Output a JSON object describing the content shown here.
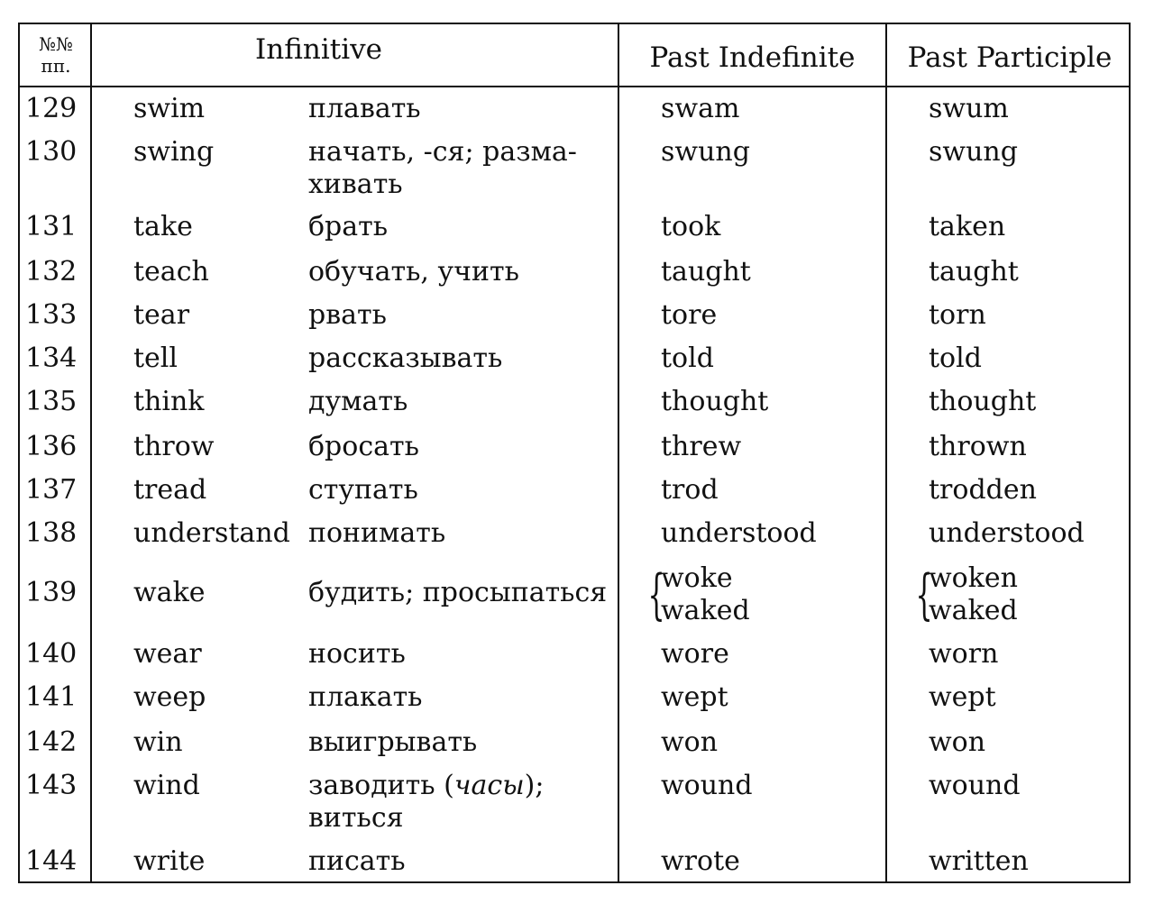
{
  "header": {
    "num_line1": "№№",
    "num_line2": "пп.",
    "infinitive": "Infinitive",
    "past_indefinite": "Past Indefinite",
    "past_participle": "Past Participle"
  },
  "rows": [
    {
      "num": "129",
      "en": "swim",
      "ru": [
        [
          {
            "t": "плавать"
          }
        ]
      ],
      "past": [
        "swam"
      ],
      "pp": [
        "swum"
      ]
    },
    {
      "num": "130",
      "en": "swing",
      "ru": [
        [
          {
            "t": "начать, -ся; разма-"
          }
        ],
        [
          {
            "t": "хивать"
          }
        ]
      ],
      "past": [
        "swung"
      ],
      "pp": [
        "swung"
      ]
    },
    {
      "num": "131",
      "en": "take",
      "ru": [
        [
          {
            "t": "брать"
          }
        ]
      ],
      "past": [
        "took"
      ],
      "pp": [
        "taken"
      ]
    },
    {
      "num": "132",
      "en": "teach",
      "ru": [
        [
          {
            "t": "обучать, учить"
          }
        ]
      ],
      "past": [
        "taught"
      ],
      "pp": [
        "taught"
      ]
    },
    {
      "num": "133",
      "en": "tear",
      "ru": [
        [
          {
            "t": "рвать"
          }
        ]
      ],
      "past": [
        "tore"
      ],
      "pp": [
        "torn"
      ]
    },
    {
      "num": "134",
      "en": "tell",
      "ru": [
        [
          {
            "t": "рассказывать"
          }
        ]
      ],
      "past": [
        "told"
      ],
      "pp": [
        "told"
      ]
    },
    {
      "num": "135",
      "en": "think",
      "ru": [
        [
          {
            "t": "думать"
          }
        ]
      ],
      "past": [
        "thought"
      ],
      "pp": [
        "thought"
      ]
    },
    {
      "num": "136",
      "en": "throw",
      "ru": [
        [
          {
            "t": "бросать"
          }
        ]
      ],
      "past": [
        "threw"
      ],
      "pp": [
        "thrown"
      ]
    },
    {
      "num": "137",
      "en": "tread",
      "ru": [
        [
          {
            "t": "ступать"
          }
        ]
      ],
      "past": [
        "trod"
      ],
      "pp": [
        "trodden"
      ]
    },
    {
      "num": "138",
      "en": "understand",
      "ru": [
        [
          {
            "t": "понимать"
          }
        ]
      ],
      "past": [
        "understood"
      ],
      "pp": [
        "understood"
      ]
    },
    {
      "num": "139",
      "en": "wake",
      "ru": [
        [
          {
            "t": "будить; просыпаться"
          }
        ]
      ],
      "past": [
        "woke",
        "waked"
      ],
      "pp": [
        "woken",
        "waked"
      ]
    },
    {
      "num": "140",
      "en": "wear",
      "ru": [
        [
          {
            "t": "носить"
          }
        ]
      ],
      "past": [
        "wore"
      ],
      "pp": [
        "worn"
      ]
    },
    {
      "num": "141",
      "en": "weep",
      "ru": [
        [
          {
            "t": "плакать"
          }
        ]
      ],
      "past": [
        "wept"
      ],
      "pp": [
        "wept"
      ]
    },
    {
      "num": "142",
      "en": "win",
      "ru": [
        [
          {
            "t": "выигрывать"
          }
        ]
      ],
      "past": [
        "won"
      ],
      "pp": [
        "won"
      ]
    },
    {
      "num": "143",
      "en": "wind",
      "ru": [
        [
          {
            "t": "заводить ("
          },
          {
            "t": "часы",
            "i": true
          },
          {
            "t": ");"
          }
        ],
        [
          {
            "t": "виться"
          }
        ]
      ],
      "past": [
        "wound"
      ],
      "pp": [
        "wound"
      ]
    },
    {
      "num": "144",
      "en": "write",
      "ru": [
        [
          {
            "t": "писать"
          }
        ]
      ],
      "past": [
        "wrote"
      ],
      "pp": [
        "written"
      ]
    }
  ]
}
